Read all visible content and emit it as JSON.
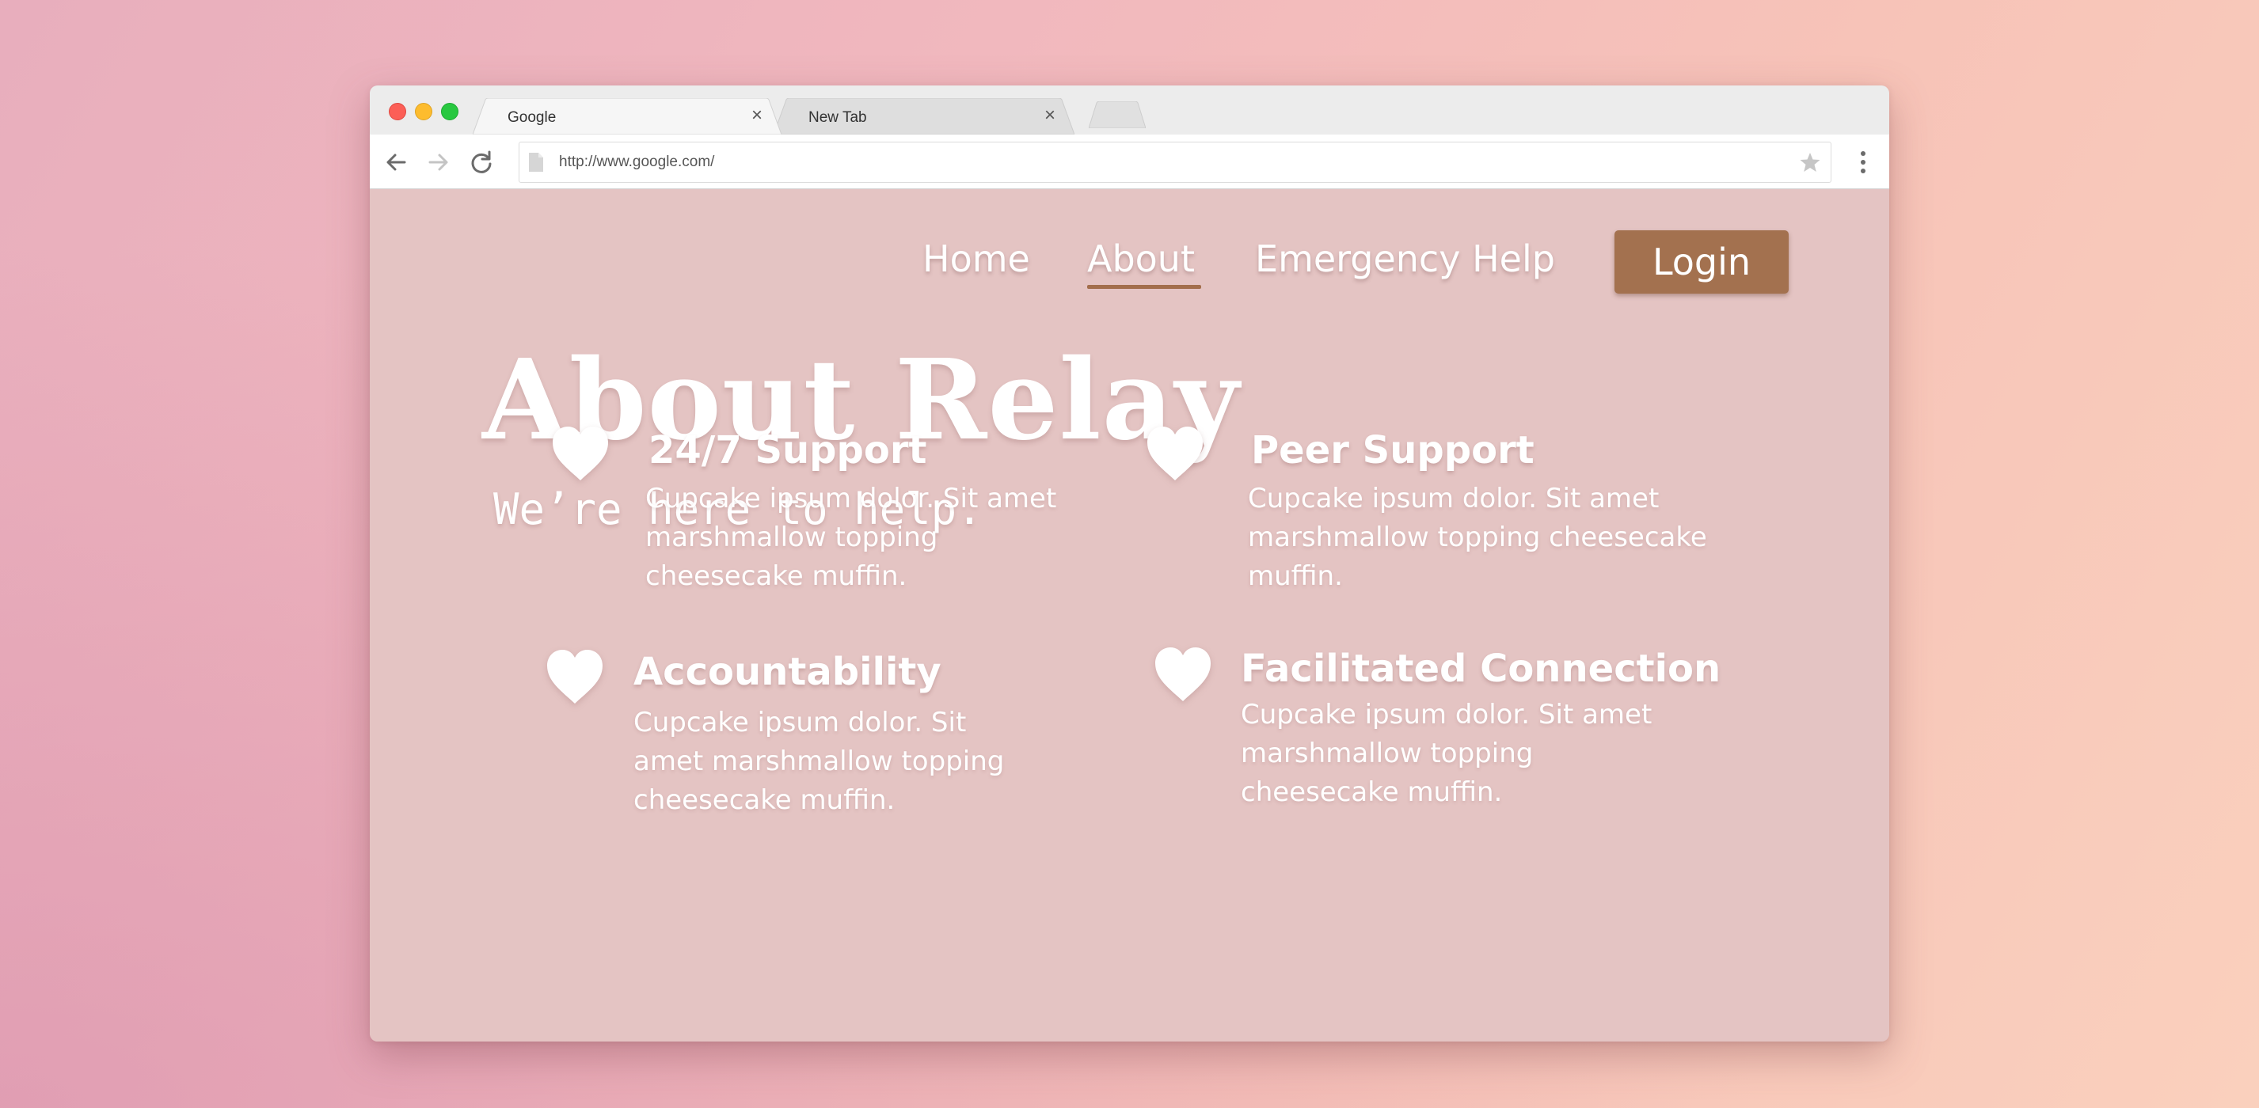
{
  "browser": {
    "tabs": [
      {
        "title": "Google",
        "active": true
      },
      {
        "title": "New Tab",
        "active": false
      }
    ],
    "close_glyph": "×",
    "url": "http://www.google.com/"
  },
  "site": {
    "nav": {
      "home": "Home",
      "about": "About",
      "emergency": "Emergency Help",
      "login": "Login"
    },
    "hero": {
      "title": "About Relay",
      "subtitle": "We’re here to help."
    },
    "features": [
      {
        "icon": "heart-icon",
        "title": "24/7 Support",
        "description": "Cupcake ipsum dolor. Sit amet marshmallow topping cheesecake muffin."
      },
      {
        "icon": "heart-icon",
        "title": "Peer Support",
        "description": "Cupcake ipsum dolor. Sit amet marshmallow topping cheesecake muffin."
      },
      {
        "icon": "heart-icon",
        "title": "Accountability",
        "description": "Cupcake ipsum dolor. Sit amet marshmallow topping cheesecake muffin."
      },
      {
        "icon": "heart-icon",
        "title": "Facilitated Connection",
        "description": "Cupcake ipsum dolor. Sit amet marshmallow topping cheesecake muffin."
      }
    ]
  },
  "colors": {
    "page_background": "#e4c4c3",
    "accent": "#a3714f",
    "text": "#ffffff"
  }
}
